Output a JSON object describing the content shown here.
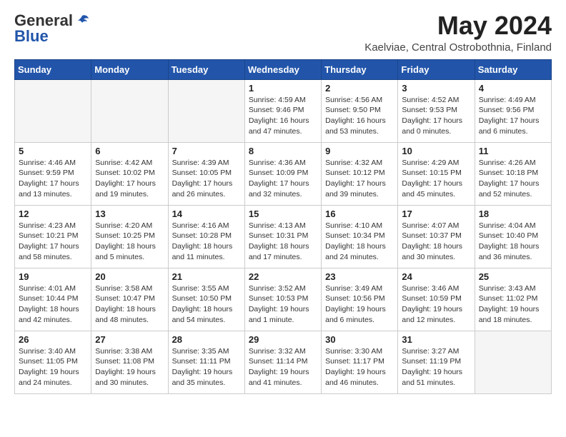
{
  "header": {
    "logo_general": "General",
    "logo_blue": "Blue",
    "main_title": "May 2024",
    "subtitle": "Kaelviae, Central Ostrobothnia, Finland"
  },
  "weekdays": [
    "Sunday",
    "Monday",
    "Tuesday",
    "Wednesday",
    "Thursday",
    "Friday",
    "Saturday"
  ],
  "weeks": [
    [
      {
        "day": "",
        "sunrise": "",
        "sunset": "",
        "daylight": ""
      },
      {
        "day": "",
        "sunrise": "",
        "sunset": "",
        "daylight": ""
      },
      {
        "day": "",
        "sunrise": "",
        "sunset": "",
        "daylight": ""
      },
      {
        "day": "1",
        "sunrise": "Sunrise: 4:59 AM",
        "sunset": "Sunset: 9:46 PM",
        "daylight": "Daylight: 16 hours and 47 minutes."
      },
      {
        "day": "2",
        "sunrise": "Sunrise: 4:56 AM",
        "sunset": "Sunset: 9:50 PM",
        "daylight": "Daylight: 16 hours and 53 minutes."
      },
      {
        "day": "3",
        "sunrise": "Sunrise: 4:52 AM",
        "sunset": "Sunset: 9:53 PM",
        "daylight": "Daylight: 17 hours and 0 minutes."
      },
      {
        "day": "4",
        "sunrise": "Sunrise: 4:49 AM",
        "sunset": "Sunset: 9:56 PM",
        "daylight": "Daylight: 17 hours and 6 minutes."
      }
    ],
    [
      {
        "day": "5",
        "sunrise": "Sunrise: 4:46 AM",
        "sunset": "Sunset: 9:59 PM",
        "daylight": "Daylight: 17 hours and 13 minutes."
      },
      {
        "day": "6",
        "sunrise": "Sunrise: 4:42 AM",
        "sunset": "Sunset: 10:02 PM",
        "daylight": "Daylight: 17 hours and 19 minutes."
      },
      {
        "day": "7",
        "sunrise": "Sunrise: 4:39 AM",
        "sunset": "Sunset: 10:05 PM",
        "daylight": "Daylight: 17 hours and 26 minutes."
      },
      {
        "day": "8",
        "sunrise": "Sunrise: 4:36 AM",
        "sunset": "Sunset: 10:09 PM",
        "daylight": "Daylight: 17 hours and 32 minutes."
      },
      {
        "day": "9",
        "sunrise": "Sunrise: 4:32 AM",
        "sunset": "Sunset: 10:12 PM",
        "daylight": "Daylight: 17 hours and 39 minutes."
      },
      {
        "day": "10",
        "sunrise": "Sunrise: 4:29 AM",
        "sunset": "Sunset: 10:15 PM",
        "daylight": "Daylight: 17 hours and 45 minutes."
      },
      {
        "day": "11",
        "sunrise": "Sunrise: 4:26 AM",
        "sunset": "Sunset: 10:18 PM",
        "daylight": "Daylight: 17 hours and 52 minutes."
      }
    ],
    [
      {
        "day": "12",
        "sunrise": "Sunrise: 4:23 AM",
        "sunset": "Sunset: 10:21 PM",
        "daylight": "Daylight: 17 hours and 58 minutes."
      },
      {
        "day": "13",
        "sunrise": "Sunrise: 4:20 AM",
        "sunset": "Sunset: 10:25 PM",
        "daylight": "Daylight: 18 hours and 5 minutes."
      },
      {
        "day": "14",
        "sunrise": "Sunrise: 4:16 AM",
        "sunset": "Sunset: 10:28 PM",
        "daylight": "Daylight: 18 hours and 11 minutes."
      },
      {
        "day": "15",
        "sunrise": "Sunrise: 4:13 AM",
        "sunset": "Sunset: 10:31 PM",
        "daylight": "Daylight: 18 hours and 17 minutes."
      },
      {
        "day": "16",
        "sunrise": "Sunrise: 4:10 AM",
        "sunset": "Sunset: 10:34 PM",
        "daylight": "Daylight: 18 hours and 24 minutes."
      },
      {
        "day": "17",
        "sunrise": "Sunrise: 4:07 AM",
        "sunset": "Sunset: 10:37 PM",
        "daylight": "Daylight: 18 hours and 30 minutes."
      },
      {
        "day": "18",
        "sunrise": "Sunrise: 4:04 AM",
        "sunset": "Sunset: 10:40 PM",
        "daylight": "Daylight: 18 hours and 36 minutes."
      }
    ],
    [
      {
        "day": "19",
        "sunrise": "Sunrise: 4:01 AM",
        "sunset": "Sunset: 10:44 PM",
        "daylight": "Daylight: 18 hours and 42 minutes."
      },
      {
        "day": "20",
        "sunrise": "Sunrise: 3:58 AM",
        "sunset": "Sunset: 10:47 PM",
        "daylight": "Daylight: 18 hours and 48 minutes."
      },
      {
        "day": "21",
        "sunrise": "Sunrise: 3:55 AM",
        "sunset": "Sunset: 10:50 PM",
        "daylight": "Daylight: 18 hours and 54 minutes."
      },
      {
        "day": "22",
        "sunrise": "Sunrise: 3:52 AM",
        "sunset": "Sunset: 10:53 PM",
        "daylight": "Daylight: 19 hours and 1 minute."
      },
      {
        "day": "23",
        "sunrise": "Sunrise: 3:49 AM",
        "sunset": "Sunset: 10:56 PM",
        "daylight": "Daylight: 19 hours and 6 minutes."
      },
      {
        "day": "24",
        "sunrise": "Sunrise: 3:46 AM",
        "sunset": "Sunset: 10:59 PM",
        "daylight": "Daylight: 19 hours and 12 minutes."
      },
      {
        "day": "25",
        "sunrise": "Sunrise: 3:43 AM",
        "sunset": "Sunset: 11:02 PM",
        "daylight": "Daylight: 19 hours and 18 minutes."
      }
    ],
    [
      {
        "day": "26",
        "sunrise": "Sunrise: 3:40 AM",
        "sunset": "Sunset: 11:05 PM",
        "daylight": "Daylight: 19 hours and 24 minutes."
      },
      {
        "day": "27",
        "sunrise": "Sunrise: 3:38 AM",
        "sunset": "Sunset: 11:08 PM",
        "daylight": "Daylight: 19 hours and 30 minutes."
      },
      {
        "day": "28",
        "sunrise": "Sunrise: 3:35 AM",
        "sunset": "Sunset: 11:11 PM",
        "daylight": "Daylight: 19 hours and 35 minutes."
      },
      {
        "day": "29",
        "sunrise": "Sunrise: 3:32 AM",
        "sunset": "Sunset: 11:14 PM",
        "daylight": "Daylight: 19 hours and 41 minutes."
      },
      {
        "day": "30",
        "sunrise": "Sunrise: 3:30 AM",
        "sunset": "Sunset: 11:17 PM",
        "daylight": "Daylight: 19 hours and 46 minutes."
      },
      {
        "day": "31",
        "sunrise": "Sunrise: 3:27 AM",
        "sunset": "Sunset: 11:19 PM",
        "daylight": "Daylight: 19 hours and 51 minutes."
      },
      {
        "day": "",
        "sunrise": "",
        "sunset": "",
        "daylight": ""
      }
    ]
  ]
}
